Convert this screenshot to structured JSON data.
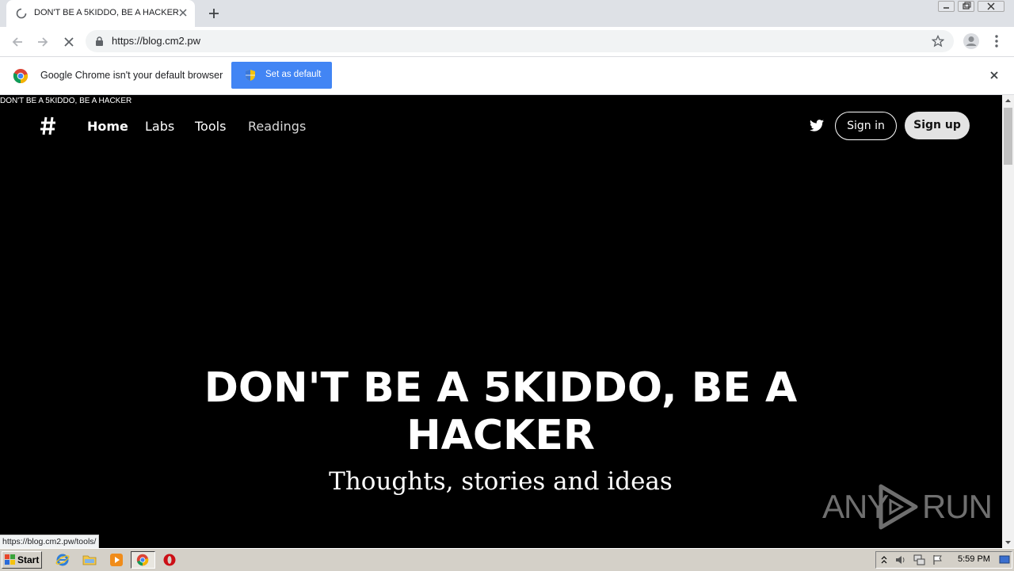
{
  "browser": {
    "tab": {
      "title": "DON'T BE A 5KIDDO, BE A HACKER"
    },
    "omnibox": {
      "url": "https://blog.cm2.pw"
    },
    "infobar": {
      "message": "Google Chrome isn't your default browser",
      "button_label": "Set as default"
    },
    "status_url": "https://blog.cm2.pw/tools/"
  },
  "page": {
    "broken_image_alt": "DON'T BE A 5KIDDO, BE A HACKER",
    "nav": [
      {
        "label": "Home"
      },
      {
        "label": "Labs"
      },
      {
        "label": "Tools"
      },
      {
        "label": "Readings"
      }
    ],
    "signin_label": "Sign in",
    "signup_label": "Sign up",
    "hero": {
      "title": "DON'T BE A 5KIDDO, BE A HACKER",
      "subtitle": "Thoughts, stories and ideas"
    },
    "watermark": {
      "left": "ANY",
      "right": "RUN"
    }
  },
  "taskbar": {
    "start_label": "Start",
    "clock": "5:59 PM"
  },
  "colors": {
    "accent": "#4285f4",
    "page_bg": "#000000",
    "taskbar": "#d4d0c8"
  },
  "icons": [
    "loading-spinner-icon",
    "close-icon",
    "plus-icon",
    "back-arrow-icon",
    "forward-arrow-icon",
    "stop-icon",
    "lock-icon",
    "star-icon",
    "profile-icon",
    "menu-dots-icon",
    "chrome-logo-icon",
    "shield-icon",
    "hash-logo-icon",
    "twitter-icon"
  ]
}
